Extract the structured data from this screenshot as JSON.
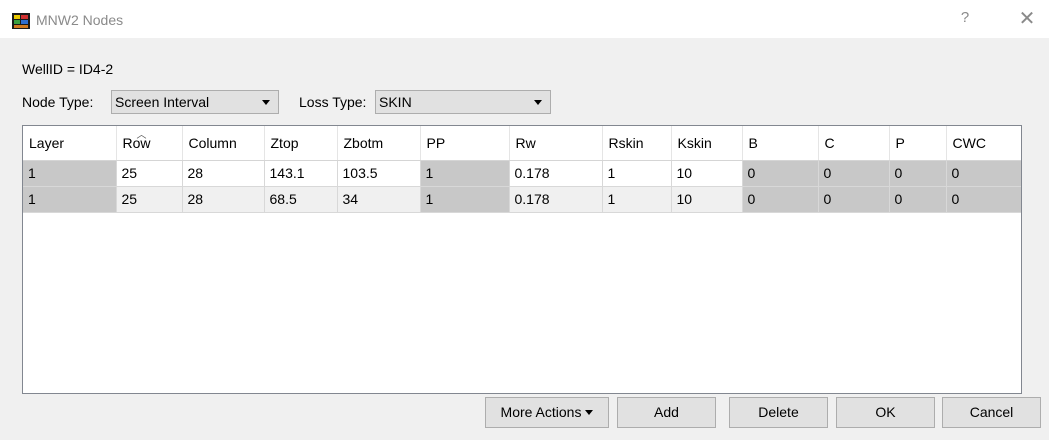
{
  "window": {
    "title": "MNW2 Nodes",
    "help_label": "?",
    "close_label": "✕"
  },
  "well": {
    "label": "WellID = ID4-2"
  },
  "node_type": {
    "label": "Node Type:",
    "value": "Screen Interval"
  },
  "loss_type": {
    "label": "Loss Type:",
    "value": "SKIN"
  },
  "table": {
    "columns": [
      "Layer",
      "Row",
      "Column",
      "Ztop",
      "Zbotm",
      "PP",
      "Rw",
      "Rskin",
      "Kskin",
      "B",
      "C",
      "P",
      "CWC"
    ],
    "rows": [
      [
        "1",
        "25",
        "28",
        "143.1",
        "103.5",
        "1",
        "0.178",
        "1",
        "10",
        "0",
        "0",
        "0",
        "0"
      ],
      [
        "1",
        "25",
        "28",
        "68.5",
        "34",
        "1",
        "0.178",
        "1",
        "10",
        "0",
        "0",
        "0",
        "0"
      ]
    ]
  },
  "buttons": {
    "more_actions": "More Actions",
    "add": "Add",
    "delete": "Delete",
    "ok": "OK",
    "cancel": "Cancel"
  }
}
